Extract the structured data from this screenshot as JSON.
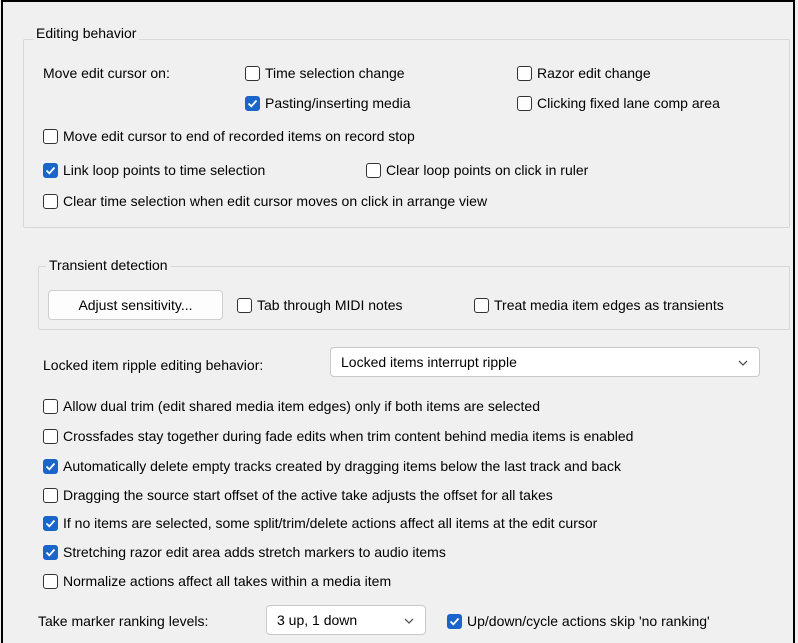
{
  "editing_group": {
    "title": "Editing behavior",
    "move_edit_cursor_label": "Move edit cursor on:",
    "opt_time_selection_change": {
      "label": "Time selection change",
      "checked": false
    },
    "opt_razor_edit_change": {
      "label": "Razor edit change",
      "checked": false
    },
    "opt_pasting_inserting_media": {
      "label": "Pasting/inserting media",
      "checked": true
    },
    "opt_clicking_fixed_lane": {
      "label": "Clicking fixed lane comp area",
      "checked": false
    },
    "opt_move_cursor_end_recorded": {
      "label": "Move edit cursor to end of recorded items on record stop",
      "checked": false
    },
    "opt_link_loop_points": {
      "label": "Link loop points to time selection",
      "checked": true
    },
    "opt_clear_loop_points": {
      "label": "Clear loop points on click in ruler",
      "checked": false
    },
    "opt_clear_time_selection": {
      "label": "Clear time selection when edit cursor moves on click in arrange view",
      "checked": false
    }
  },
  "transient_group": {
    "title": "Transient detection",
    "adjust_button": "Adjust sensitivity...",
    "opt_tab_midi": {
      "label": "Tab through MIDI notes",
      "checked": false
    },
    "opt_treat_edges": {
      "label": "Treat media item edges as transients",
      "checked": false
    }
  },
  "ripple": {
    "label": "Locked item ripple editing behavior:",
    "selected": "Locked items interrupt ripple"
  },
  "options": [
    {
      "label": "Allow dual trim (edit shared media item edges) only if both items are selected",
      "checked": false
    },
    {
      "label": "Crossfades stay together during fade edits when trim content behind media items is enabled",
      "checked": false
    },
    {
      "label": "Automatically delete empty tracks created by dragging items below the last track and back",
      "checked": true
    },
    {
      "label": "Dragging the source start offset of the active take adjusts the offset for all takes",
      "checked": false
    },
    {
      "label": "If no items are selected, some split/trim/delete actions affect all items at the edit cursor",
      "checked": true
    },
    {
      "label": "Stretching razor edit area adds stretch markers to audio items",
      "checked": true
    },
    {
      "label": "Normalize actions affect all takes within a media item",
      "checked": false
    }
  ],
  "take_marker": {
    "label": "Take marker ranking levels:",
    "selected": "3 up, 1 down",
    "opt_skip_no_ranking": {
      "label": "Up/down/cycle actions skip 'no ranking'",
      "checked": true
    }
  },
  "colors": {
    "accent": "#1a65c9",
    "background": "#f0f0f0"
  }
}
